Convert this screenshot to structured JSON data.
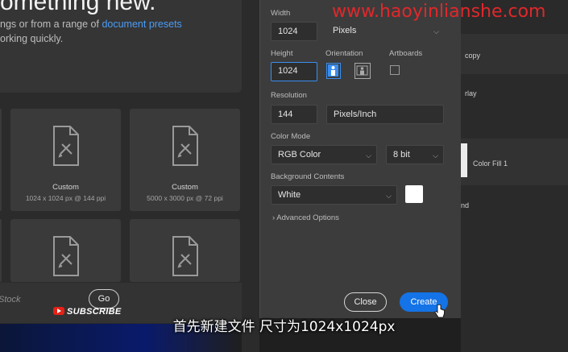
{
  "hero": {
    "title": "omething new.",
    "line1_prefix": "ngs or from a range of ",
    "line1_link": "document presets",
    "line2": "orking quickly."
  },
  "presets": [
    {
      "name": "Custom",
      "detail": "1024 x 1024 px @ 144 ppi"
    },
    {
      "name": "Custom",
      "detail": "5000 x 3000 px @ 72 ppi"
    }
  ],
  "bottom": {
    "stock_text": "Stock",
    "go_label": "Go",
    "subscribe_label": "SUBSCRIBE"
  },
  "dialog": {
    "width_label": "Width",
    "width_value": "1024",
    "width_unit": "Pixels",
    "height_label": "Height",
    "height_value": "1024",
    "orientation_label": "Orientation",
    "artboards_label": "Artboards",
    "resolution_label": "Resolution",
    "resolution_value": "144",
    "resolution_unit": "Pixels/Inch",
    "color_mode_label": "Color Mode",
    "color_mode_value": "RGB Color",
    "bit_depth_value": "8 bit",
    "background_label": "Background Contents",
    "background_value": "White",
    "advanced_label": "Advanced Options",
    "close_label": "Close",
    "create_label": "Create"
  },
  "layers": {
    "row1": "copy",
    "row2": "rlay",
    "row3": "Color Fill 1",
    "row4": "nd"
  },
  "watermark": "www.haoyinlianshe.com",
  "caption": "首先新建文件 尺寸为1024x1024px",
  "colors": {
    "accent": "#1473e6",
    "watermark": "#e0282b"
  }
}
